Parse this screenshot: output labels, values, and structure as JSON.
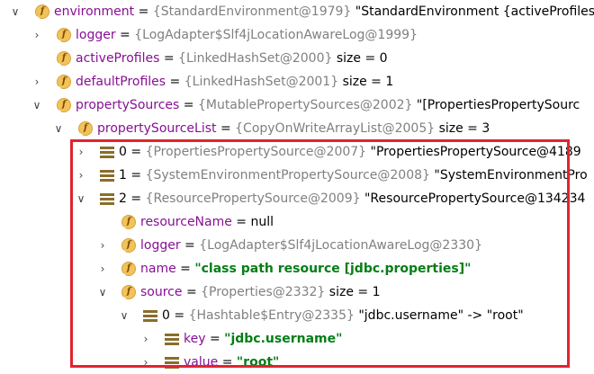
{
  "rows": [
    {
      "name": "environment",
      "eq": " = ",
      "type": "{StandardEnvironment@1979}",
      "extra": " \"StandardEnvironment {activeProfiles"
    },
    {
      "name": "logger",
      "eq": " = ",
      "type": "{LogAdapter$Slf4jLocationAwareLog@1999}"
    },
    {
      "name": "activeProfiles",
      "eq": " = ",
      "type": "{LinkedHashSet@2000}",
      "extra": "  size = 0"
    },
    {
      "name": "defaultProfiles",
      "eq": " = ",
      "type": "{LinkedHashSet@2001}",
      "extra": "  size = 1"
    },
    {
      "name": "propertySources",
      "eq": " = ",
      "type": "{MutablePropertySources@2002}",
      "extra": " \"[PropertiesPropertySourc"
    },
    {
      "name": "propertySourceList",
      "eq": " = ",
      "type": "{CopyOnWriteArrayList@2005}",
      "extra": "  size = 3"
    },
    {
      "name": "0",
      "eq": " = ",
      "type": "{PropertiesPropertySource@2007}",
      "extra": " \"PropertiesPropertySource@4189"
    },
    {
      "name": "1",
      "eq": " = ",
      "type": "{SystemEnvironmentPropertySource@2008}",
      "extra": " \"SystemEnvironmentPro"
    },
    {
      "name": "2",
      "eq": " = ",
      "type": "{ResourcePropertySource@2009}",
      "extra": " \"ResourcePropertySource@134234"
    },
    {
      "name": "resourceName",
      "eq": " = ",
      "value": "null"
    },
    {
      "name": "logger",
      "eq": " = ",
      "type": "{LogAdapter$Slf4jLocationAwareLog@2330}"
    },
    {
      "name": "name",
      "eq": " = ",
      "value": "\"class path resource [jdbc.properties]\""
    },
    {
      "name": "source",
      "eq": " = ",
      "type": "{Properties@2332}",
      "extra": "  size = 1"
    },
    {
      "name": "0",
      "eq": " = ",
      "type": "{Hashtable$Entry@2335}",
      "extra": " \"jdbc.username\" -> \"root\""
    },
    {
      "name": "key",
      "eq": " = ",
      "value": "\"jdbc.username\""
    },
    {
      "name": "value",
      "eq": " = ",
      "value": "\"root\""
    }
  ],
  "colors": {
    "field_name": "#871094",
    "type_text": "#808080",
    "string_value": "#067d17",
    "highlight_border": "#e0242f",
    "field_icon": "#f2c35a"
  },
  "icons": {
    "expanded": "chevron-down-icon",
    "collapsed": "chevron-right-icon",
    "field": "field-icon",
    "list_entry": "list-entry-icon"
  }
}
